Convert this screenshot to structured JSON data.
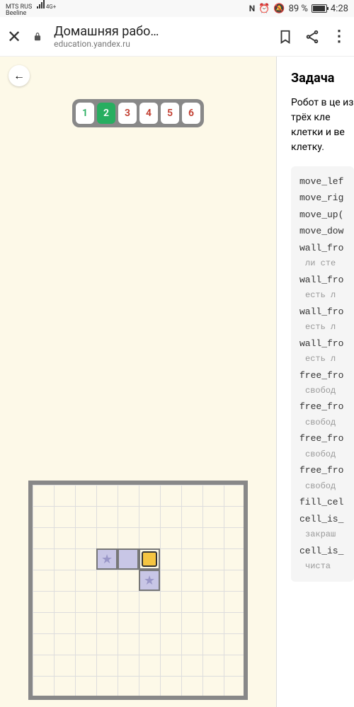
{
  "status": {
    "carrier1": "MTS RUS",
    "carrier2": "Beeline",
    "net": "4G+",
    "battery_pct": "89 %",
    "time": "4:28"
  },
  "browser": {
    "title": "Домашняя рабо…",
    "url": "education.yandex.ru"
  },
  "tabs": [
    "1",
    "2",
    "3",
    "4",
    "5",
    "6"
  ],
  "task": {
    "title": "Задача",
    "desc": "Робот в це из трёх кле клетки и ве клетку."
  },
  "code": [
    {
      "t": "move_lef"
    },
    {
      "t": "move_rig"
    },
    {
      "t": "move_up("
    },
    {
      "t": "move_dow"
    },
    {
      "t": "wall_fro"
    },
    {
      "t": "ли сте",
      "c": true
    },
    {
      "t": "wall_fro"
    },
    {
      "t": "есть л",
      "c": true
    },
    {
      "t": "wall_fro"
    },
    {
      "t": "есть л",
      "c": true
    },
    {
      "t": "wall_fro"
    },
    {
      "t": "есть л",
      "c": true
    },
    {
      "t": "free_fro"
    },
    {
      "t": "свобод",
      "c": true
    },
    {
      "t": "free_fro"
    },
    {
      "t": "свобод",
      "c": true
    },
    {
      "t": "free_fro"
    },
    {
      "t": "свобод",
      "c": true
    },
    {
      "t": "free_fro"
    },
    {
      "t": "свобод",
      "c": true
    },
    {
      "t": "fill_cel"
    },
    {
      "t": "cell_is_"
    },
    {
      "t": "закраш",
      "c": true
    },
    {
      "t": "cell_is_"
    },
    {
      "t": "чиста",
      "c": true
    }
  ]
}
